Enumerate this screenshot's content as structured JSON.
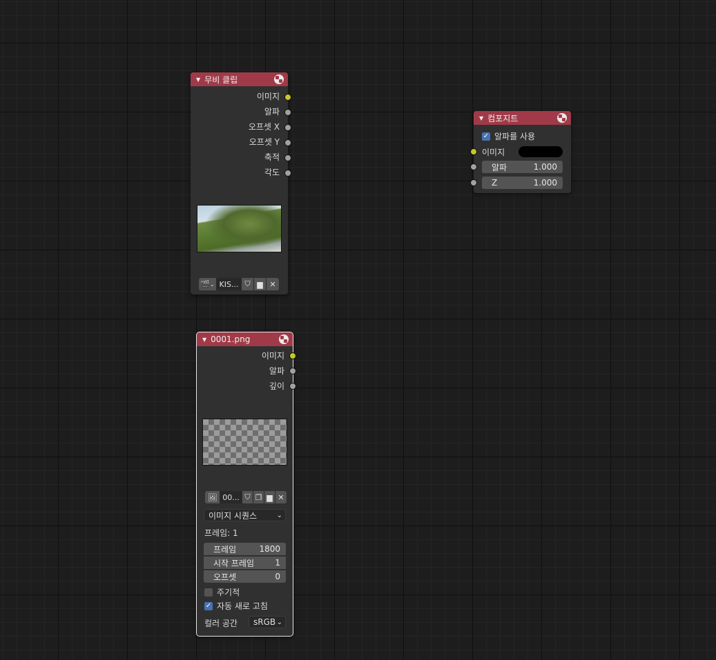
{
  "movie_clip_node": {
    "title": "무비 클립",
    "outputs": [
      "이미지",
      "알파",
      "오프셋 X",
      "오프셋 Y",
      "축적",
      "각도"
    ],
    "clip_name": "KIS..."
  },
  "composite_node": {
    "title": "컴포지트",
    "use_alpha_label": "알파를 사용",
    "use_alpha_checked": true,
    "image_label": "이미지",
    "alpha_label": "알파",
    "alpha_value": "1.000",
    "z_label": "Z",
    "z_value": "1.000"
  },
  "image_node": {
    "title": "0001.png",
    "outputs": [
      "이미지",
      "알파",
      "깊이"
    ],
    "image_name": "00...",
    "source_type": "이미지 시퀀스",
    "frame_info": "프레임: 1",
    "frames_label": "프레임",
    "frames_value": "1800",
    "start_label": "시작 프레임",
    "start_value": "1",
    "offset_label": "오프셋",
    "offset_value": "0",
    "cyclic_label": "주기적",
    "auto_refresh_label": "자동 새로 고침",
    "colorspace_label": "컬러 공간",
    "colorspace_value": "sRGB"
  },
  "colors": {
    "header": "#a13a48",
    "socket_image": "#c7c729",
    "socket_value": "#a1a1a1",
    "checkbox_on": "#4772b3"
  }
}
